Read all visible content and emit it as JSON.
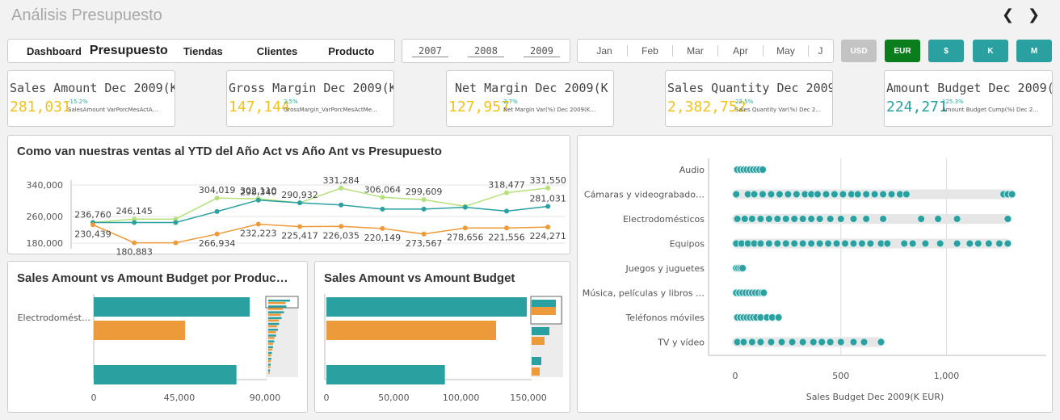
{
  "app": {
    "title": "Análisis Presupuesto",
    "prev_icon": "chevron-left-icon",
    "next_icon": "chevron-right-icon"
  },
  "tabs": [
    "Dashboard",
    "Presupuesto",
    "Tiendas",
    "Clientes",
    "Producto"
  ],
  "active_tab": "Presupuesto",
  "years": [
    "2007",
    "2008",
    "2009"
  ],
  "months": [
    "Jan",
    "Feb",
    "Mar",
    "Apr",
    "May",
    "J"
  ],
  "buttons": [
    {
      "label": "USD",
      "color": "#c3c3c3"
    },
    {
      "label": "EUR",
      "color": "#0a7d1c"
    },
    {
      "label": "$",
      "color": "#2aa0a0"
    },
    {
      "label": "K",
      "color": "#2aa0a0"
    },
    {
      "label": "M",
      "color": "#2aa0a0"
    }
  ],
  "kpis": [
    {
      "title": "Sales Amount Dec 2009(K EU…",
      "value": "281,031",
      "value_color": "#f0c21a",
      "pct": "-15.2%",
      "pct_color": "#2aa0a0",
      "sub": "SalesAmount VarPorcMesActA…"
    },
    {
      "title": "Gross Margin Dec 2009(K EUR)",
      "value": "147,144",
      "value_color": "#f0c21a",
      "pct": "2.5%",
      "pct_color": "#2aa0a0",
      "sub": "GrossMargin_VarPorcMesActMe…"
    },
    {
      "title": "Net Margin Dec 2009(K EUR)",
      "value": "127,957",
      "value_color": "#f0c21a",
      "pct": "2.7%",
      "pct_color": "#2aa0a0",
      "sub": "Net Margin Var(%) Dec 2009(K…"
    },
    {
      "title": "Sales Quantity Dec 2009(K E…",
      "value": "2,382,752",
      "value_color": "#f0c21a",
      "pct": "22.5%",
      "pct_color": "#2aa0a0",
      "sub": "Sales Quantity Var(%) Dec 2…"
    },
    {
      "title": "Amount Budget Dec 2009(K E…",
      "value": "224,271",
      "value_color": "#2aa0a0",
      "pct": "125.3%",
      "pct_color": "#2aa0a0",
      "sub": "Amount Budget Cump(%) Dec 2…"
    }
  ],
  "colors": {
    "teal": "#2aa0a0",
    "orange": "#ec9a3a",
    "light_green": "#b6e07c",
    "grid": "#e6e6e6"
  },
  "line_panel": {
    "title": "Como van nuestras ventas al YTD del Año Act vs Año Ant vs Presupuesto",
    "y_ticks": [
      "340,000",
      "260,000",
      "180,000"
    ],
    "labels": {
      "green": [
        "",
        "246,145",
        "",
        "304,019",
        "302,110",
        "",
        "331,284",
        "306,064",
        "299,609",
        "",
        "318,477",
        "331,550"
      ],
      "teal": [
        "236,760",
        "",
        "",
        "",
        "298,340",
        "290,932",
        "",
        "",
        "",
        "",
        "",
        "281,031"
      ],
      "orange": [
        "230,439",
        "180,883",
        "",
        "266,934",
        "232,223",
        "225,417",
        "226,035",
        "220,149",
        "273,567",
        "278,656",
        "221,556",
        "224,271"
      ]
    }
  },
  "chart_data": [
    {
      "type": "line",
      "title": "Como van nuestras ventas al YTD del Año Act vs Año Ant vs Presupuesto",
      "x": [
        1,
        2,
        3,
        4,
        5,
        6,
        7,
        8,
        9,
        10,
        11,
        12
      ],
      "ylim": [
        180000,
        340000
      ],
      "series": [
        {
          "values": [
            236760,
            246145,
            246145,
            304019,
            302110,
            290932,
            331284,
            306064,
            299609,
            281031,
            318477,
            331550
          ]
        },
        {
          "values": [
            236760,
            236760,
            236760,
            266934,
            298340,
            290932,
            285000,
            273567,
            273567,
            278656,
            268000,
            281031
          ]
        },
        {
          "values": [
            230439,
            180883,
            180883,
            205000,
            232223,
            225417,
            226035,
            220149,
            205000,
            221556,
            221556,
            224271
          ]
        }
      ]
    },
    {
      "type": "bar",
      "title": "Sales Amount vs Amount Budget por Produc…",
      "categories": [
        "Electrodomést…"
      ],
      "series": [
        {
          "values": [
            82000
          ]
        },
        {
          "values": [
            48000
          ]
        },
        {
          "values": [
            75000
          ]
        }
      ],
      "x_ticks": [
        "0",
        "45,000",
        "90,000"
      ],
      "xlim": [
        0,
        95000
      ]
    },
    {
      "type": "bar",
      "title": "Sales Amount vs Amount Budget",
      "series": [
        {
          "values": [
            150000
          ]
        },
        {
          "values": [
            126000
          ]
        },
        {
          "values": [
            88000
          ]
        }
      ],
      "x_ticks": [
        "0",
        "50,000",
        "100,000",
        "150,000"
      ],
      "xlim": [
        0,
        175000
      ]
    },
    {
      "type": "scatter",
      "xlabel": "Sales Budget Dec 2009(K EUR)",
      "x_ticks": [
        "0",
        "500",
        "1,000"
      ],
      "xlim": [
        0,
        1300
      ],
      "categories": [
        "Audio",
        "Cámaras y videograbado…",
        "Electrodomésticos",
        "Equipos",
        "Juegos y juguetes",
        "Música, películas y libros …",
        "Teléfonos móviles",
        "TV y vídeo"
      ],
      "points": [
        [
          10,
          25,
          40,
          55,
          70,
          85,
          100,
          115,
          130
        ],
        [
          5,
          60,
          90,
          130,
          170,
          210,
          250,
          290,
          330,
          360,
          390,
          430,
          470,
          510,
          550,
          580,
          620,
          660,
          700,
          740,
          780,
          810,
          1270,
          1290,
          1310
        ],
        [
          10,
          45,
          80,
          120,
          160,
          200,
          240,
          280,
          320,
          360,
          400,
          450,
          500,
          560,
          620,
          700,
          880,
          960,
          1050,
          1290
        ],
        [
          5,
          30,
          60,
          90,
          120,
          160,
          200,
          240,
          280,
          320,
          360,
          400,
          440,
          480,
          520,
          560,
          600,
          640,
          690,
          720,
          800,
          840,
          900,
          970,
          1050,
          1110,
          1150,
          1200,
          1250,
          1290
        ],
        [
          5,
          15,
          25,
          35
        ],
        [
          5,
          20,
          35,
          50,
          65,
          80,
          95,
          110,
          125,
          135
        ],
        [
          10,
          25,
          40,
          55,
          70,
          85,
          100,
          120,
          150,
          175,
          205
        ],
        [
          10,
          40,
          80,
          120,
          170,
          220,
          270,
          320,
          370,
          410,
          450,
          500,
          560,
          610,
          690
        ]
      ]
    }
  ]
}
